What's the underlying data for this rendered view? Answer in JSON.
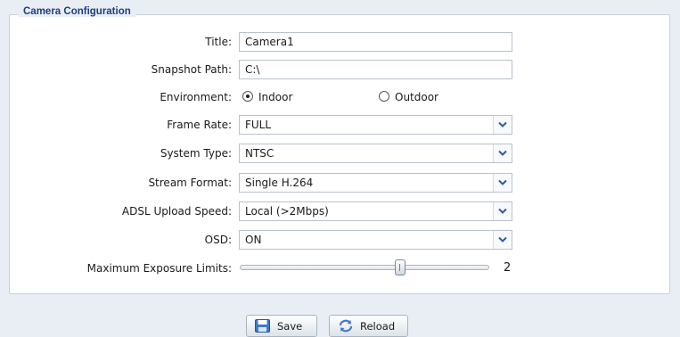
{
  "section": {
    "title": "Camera Configuration"
  },
  "fields": {
    "title": {
      "label": "Title:",
      "value": "Camera1"
    },
    "snapshot_path": {
      "label": "Snapshot Path:",
      "value": "C:\\"
    },
    "environment": {
      "label": "Environment:",
      "options": [
        {
          "label": "Indoor",
          "selected": true
        },
        {
          "label": "Outdoor",
          "selected": false
        }
      ]
    },
    "frame_rate": {
      "label": "Frame Rate:",
      "value": "FULL"
    },
    "system_type": {
      "label": "System Type:",
      "value": "NTSC"
    },
    "stream_format": {
      "label": "Stream Format:",
      "value": "Single H.264"
    },
    "adsl_upload_speed": {
      "label": "ADSL Upload Speed:",
      "value": "Local (>2Mbps)"
    },
    "osd": {
      "label": "OSD:",
      "value": "ON"
    },
    "max_exposure": {
      "label": "Maximum Exposure Limits:",
      "value": "2",
      "position_fraction": 0.65
    }
  },
  "buttons": {
    "save": "Save",
    "reload": "Reload"
  },
  "icons": {
    "dropdown": "chevron-down-icon",
    "save": "floppy-disk-icon",
    "reload": "reload-icon"
  },
  "colors": {
    "section_title": "#1d3f7a",
    "chevron": "#2b5aa8",
    "background": "#e9eef5"
  }
}
